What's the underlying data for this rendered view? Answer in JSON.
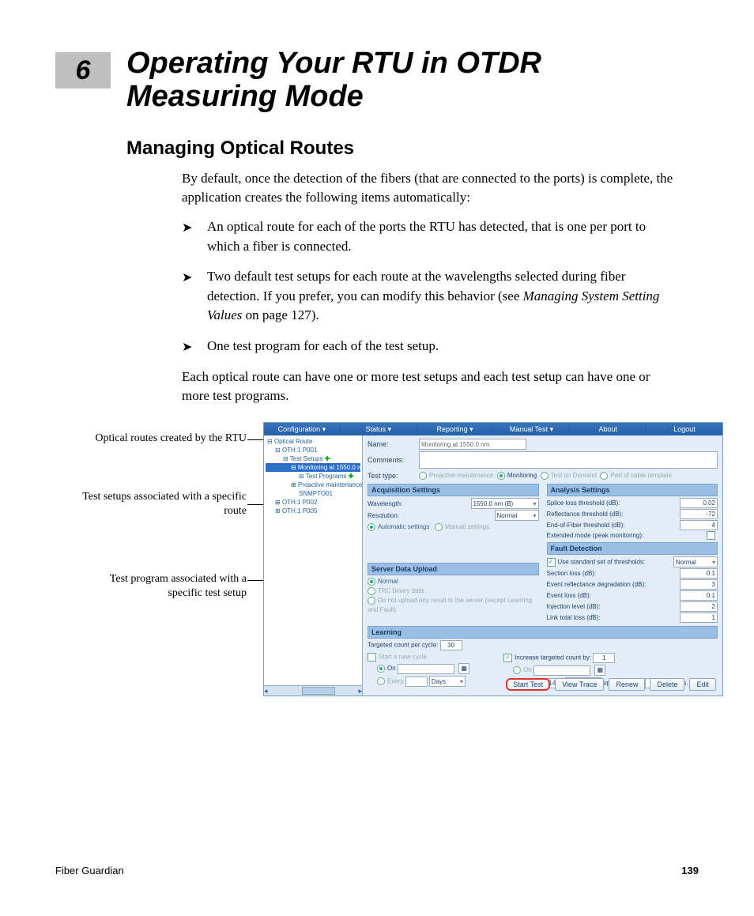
{
  "chapter": {
    "number": "6",
    "title": "Operating Your RTU in OTDR Measuring Mode"
  },
  "section": {
    "title": "Managing Optical Routes"
  },
  "paragraphs": {
    "intro": "By default, once the detection of the fibers (that are connected to the ports) is complete, the application creates the following items automatically:",
    "bullets": {
      "b1": "An optical route for each of the ports the RTU has detected, that is one per port to which a fiber is connected.",
      "b2a": "Two default test setups for each route at the wavelengths selected during fiber detection. If you prefer, you can modify this behavior (see ",
      "b2i": "Managing System Setting Values",
      "b2b": " on page 127).",
      "b3": "One test program for each of the test setup."
    },
    "after": "Each optical route can have one or more test setups and each test setup can have one or more test programs."
  },
  "callouts": {
    "c1": "Optical routes created by the RTU",
    "c2": "Test setups associated with a specific route",
    "c3": "Test program associated with a specific test setup"
  },
  "app": {
    "menu": {
      "configuration": "Configuration ▾",
      "status": "Status ▾",
      "reporting": "Reporting ▾",
      "manual": "Manual Test ▾",
      "about": "About",
      "logout": "Logout"
    },
    "tree": {
      "root": "Optical Route",
      "p001": "OTH:1 P001",
      "testSetups": "Test Setups",
      "monitoring": "Monitoring at 1550.0 nm",
      "testPrograms": "Test Programs",
      "proactive": "Proactive maintenance at",
      "snmp": "SNMPTO01",
      "p002": "OTH:1 P002",
      "p005": "OTH:1 P005"
    },
    "form": {
      "nameLabel": "Name:",
      "nameValue": "Monitoring at 1550.0 nm",
      "commentsLabel": "Comments:",
      "testTypeLabel": "Test type:",
      "typeProactive": "Proactive maintenance",
      "typeMonitoring": "Monitoring",
      "typeOnDemand": "Test on Demand",
      "typeTemplate": "Part of cable template"
    },
    "acq": {
      "header": "Acquisition Settings",
      "wavelengthLabel": "Wavelength:",
      "wavelengthValue": "1550.0 nm (B)",
      "resolutionLabel": "Resolution:",
      "resolutionValue": "Normal",
      "autoSettings": "Automatic settings",
      "manualSettings": "Manual settings"
    },
    "analysis": {
      "header": "Analysis Settings",
      "splice": "Splice loss threshold (dB):",
      "spliceV": "0.02",
      "refl": "Reflectance threshold (dB):",
      "reflV": "-72",
      "eof": "End-of-Fiber threshold (dB):",
      "eofV": "4",
      "ext": "Extended mode (peak monitoring):"
    },
    "fault": {
      "header": "Fault Detection",
      "useStd": "Use standard set of thresholds:",
      "useStdV": "Normal",
      "section": "Section loss (dB):",
      "sectionV": "0.1",
      "erd": "Event reflectance degradation (dB):",
      "erdV": "3",
      "eventLoss": "Event loss (dB):",
      "eventLossV": "0.1",
      "inj": "Injection level (dB):",
      "injV": "2",
      "link": "Link total loss (dB):",
      "linkV": "1"
    },
    "upload": {
      "header": "Server Data Upload",
      "normal": "Normal",
      "trc": "TRC binary data",
      "none": "Do not upload any result to the server (except Learning and Fault)"
    },
    "learning": {
      "header": "Learning",
      "targeted": "Targeted count per cycle:",
      "targetedV": "30",
      "startNew": "Start a new cycle",
      "increase": "Increase targeted count by:",
      "increaseV": "1",
      "on": "On",
      "every": "Every",
      "everyN": "14",
      "days": "Days",
      "upto": "up to a max of",
      "maxV": "54",
      "traces": "traces."
    },
    "buttons": {
      "start": "Start Test",
      "view": "View Trace",
      "renew": "Renew",
      "delete": "Delete",
      "edit": "Edit"
    }
  },
  "footer": {
    "product": "Fiber Guardian",
    "page": "139"
  }
}
